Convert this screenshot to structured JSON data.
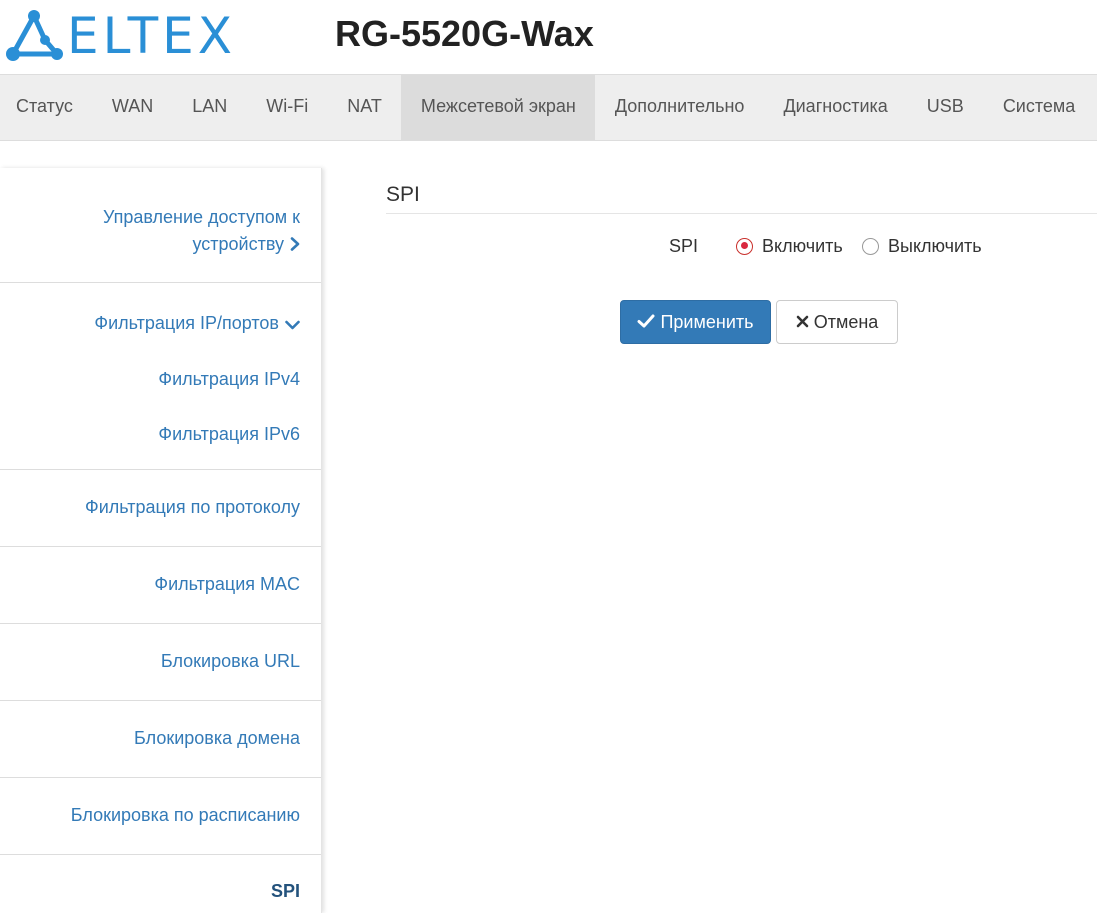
{
  "brand": {
    "logo_text": "ELTEX",
    "model": "RG-5520G-Wax",
    "accent_color": "#2a8fd6"
  },
  "topnav": {
    "tabs": [
      {
        "label": "Статус",
        "active": false
      },
      {
        "label": "WAN",
        "active": false
      },
      {
        "label": "LAN",
        "active": false
      },
      {
        "label": "Wi-Fi",
        "active": false
      },
      {
        "label": "NAT",
        "active": false
      },
      {
        "label": "Межсетевой экран",
        "active": true
      },
      {
        "label": "Дополнительно",
        "active": false
      },
      {
        "label": "Диагностика",
        "active": false
      },
      {
        "label": "USB",
        "active": false
      },
      {
        "label": "Система",
        "active": false
      }
    ]
  },
  "sidebar": {
    "access_line1": "Управление доступом к",
    "access_line2": "устройству",
    "ip_port_filter": "Фильтрация IP/портов",
    "ipv4_filter": "Фильтрация IPv4",
    "ipv6_filter": "Фильтрация IPv6",
    "protocol_filter": "Фильтрация по протоколу",
    "mac_filter": "Фильтрация MAC",
    "url_block": "Блокировка URL",
    "domain_block": "Блокировка домена",
    "schedule_block": "Блокировка по расписанию",
    "spi": "SPI"
  },
  "content": {
    "title": "SPI",
    "spi_label": "SPI",
    "enable_label": "Включить",
    "disable_label": "Выключить",
    "selected": "enable",
    "apply_label": "Применить",
    "cancel_label": "Отмена"
  },
  "colors": {
    "link": "#337ab7",
    "primary_button": "#337ab7",
    "radio_checked": "#d9283f"
  },
  "icons": {
    "logo": "eltex-network-logo-icon",
    "chevron_right": "chevron-right-icon",
    "chevron_down": "chevron-down-icon",
    "check": "check-icon",
    "close": "close-icon"
  }
}
